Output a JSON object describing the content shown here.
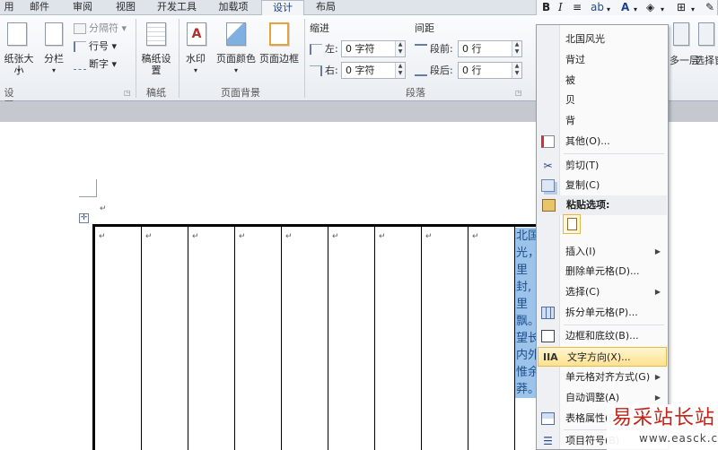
{
  "tabs": [
    "用",
    "邮件",
    "审阅",
    "视图",
    "开发工具",
    "加载项",
    "设计",
    "布局"
  ],
  "ribbon": {
    "page_setup": {
      "size_label": "纸张大小",
      "columns_label": "分栏",
      "breaks_label": "分隔符",
      "line_numbers_label": "行号",
      "hyphenation_label": "断字",
      "group_label": "设置"
    },
    "manuscript": {
      "label": "稿纸设置",
      "group_label": "稿纸"
    },
    "page_background": {
      "watermark_label": "水印",
      "page_color_label": "页面颜色",
      "page_borders_label": "页面边框",
      "group_label": "页面背景"
    },
    "paragraph": {
      "indent_title": "缩进",
      "indent_left_label": "左:",
      "indent_left_value": "0 字符",
      "indent_right_label": "右:",
      "indent_right_value": "0 字符",
      "spacing_title": "间距",
      "spacing_before_label": "段前:",
      "spacing_before_value": "0 行",
      "spacing_after_label": "段后:",
      "spacing_after_value": "0 行",
      "group_label": "段落"
    },
    "right_partial": {
      "label1": "多一层",
      "label2": "选择窗"
    }
  },
  "mini_toolbar": {
    "bold": "B",
    "italic": "I"
  },
  "document": {
    "selected_text_lines": [
      "北国",
      "光，",
      "里",
      "封,",
      "里",
      "飘。",
      "望长",
      "内外",
      "惟余",
      "莽。"
    ]
  },
  "context_menu": {
    "top_items": [
      "北国风光",
      "背过",
      "被",
      "贝",
      "背",
      "其他(O)..."
    ],
    "cut": "剪切(T)",
    "copy": "复制(C)",
    "paste_options": "粘贴选项:",
    "insert": "插入(I)",
    "delete_cells": "删除单元格(D)...",
    "select": "选择(C)",
    "split_cells": "拆分单元格(P)...",
    "borders_shading": "边框和底纹(B)...",
    "text_direction": "文字方向(X)...",
    "cell_alignment": "单元格对齐方式(G)",
    "autofit": "自动调整(A)",
    "table_properties": "表格属性(R)...",
    "bullets": "项目符号(B)"
  },
  "watermark": {
    "site_name": "易采站长站",
    "url": "www.easck.com"
  },
  "colors": {
    "accent": "#2b579a",
    "selection": "#9cc3ea",
    "highlight": "#ffe28f",
    "watermark_red": "#c22418"
  }
}
